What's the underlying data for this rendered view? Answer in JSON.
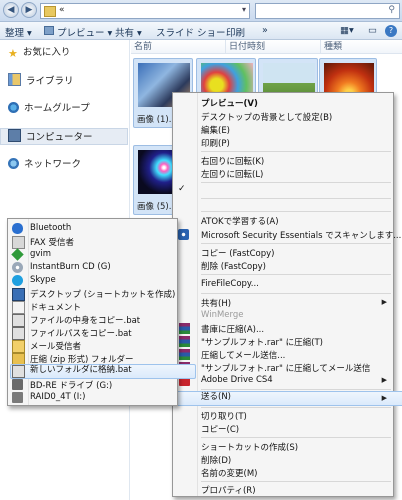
{
  "colors": {
    "accent": "#3a78c3",
    "menu_bg": "#f5f5f5",
    "highlight": "#dbeafb"
  },
  "address": {
    "path": "«",
    "nav_back_icon": "back-arrow-icon",
    "nav_forward_icon": "forward-arrow-icon"
  },
  "toolbar": {
    "organize": "整理 ▾",
    "preview": "プレビュー ▾",
    "share": "共有 ▾",
    "slideshow": "スライド ショー",
    "print": "印刷",
    "more": "»"
  },
  "nav": {
    "items": [
      {
        "label": "お気に入り",
        "icon": "star-icon"
      },
      {
        "label": "ライブラリ",
        "icon": "library-icon"
      },
      {
        "label": "ホームグループ",
        "icon": "homegroup-icon"
      },
      {
        "label": "コンピューター",
        "icon": "computer-icon"
      },
      {
        "label": "ネットワーク",
        "icon": "network-icon"
      }
    ]
  },
  "columns": {
    "name": "名前",
    "date": "日付時刻",
    "type": "種類"
  },
  "thumbs": [
    {
      "label": "画像 (1)."
    },
    {
      "label": ""
    },
    {
      "label": ""
    },
    {
      "label": ""
    },
    {
      "label": "画像 (5)."
    }
  ],
  "main_menu": {
    "items": [
      {
        "label": "プレビュー(V)",
        "bold": true
      },
      {
        "label": "デスクトップの背景として設定(B)"
      },
      {
        "label": "編集(E)"
      },
      {
        "label": "印刷(P)"
      },
      {
        "label": "右回りに回転(K)"
      },
      {
        "label": "左回りに回転(L)"
      },
      {
        "label": "ATOKで学習する(A)"
      },
      {
        "label": "Microsoft Security Essentials でスキャンします..."
      },
      {
        "label": "コピー (FastCopy)"
      },
      {
        "label": "削除  (FastCopy)"
      },
      {
        "label": "FireFileCopy..."
      },
      {
        "label": "共有(H)"
      },
      {
        "label": "WinMerge"
      },
      {
        "label": "書庫に圧縮(A)..."
      },
      {
        "label": "\"サンプルフォト.rar\" に圧縮(T)"
      },
      {
        "label": "圧縮してメール送信..."
      },
      {
        "label": "\"サンプルフォト.rar\" に圧縮してメール送信"
      },
      {
        "label": "Adobe Drive CS4"
      },
      {
        "label": "送る(N)"
      },
      {
        "label": "切り取り(T)"
      },
      {
        "label": "コピー(C)"
      },
      {
        "label": "ショートカットの作成(S)"
      },
      {
        "label": "削除(D)"
      },
      {
        "label": "名前の変更(M)"
      },
      {
        "label": "プロパティ(R)"
      }
    ]
  },
  "sendto_menu": {
    "items": [
      {
        "label": "Bluetooth"
      },
      {
        "label": "FAX 受信者"
      },
      {
        "label": "gvim"
      },
      {
        "label": "InstantBurn CD (G)"
      },
      {
        "label": "Skype"
      },
      {
        "label": "デスクトップ (ショートカットを作成)"
      },
      {
        "label": "ドキュメント"
      },
      {
        "label": "ファイルの中身をコピー.bat"
      },
      {
        "label": "ファイルパスをコピー.bat"
      },
      {
        "label": "メール受信者"
      },
      {
        "label": "圧縮 (zip 形式) フォルダー"
      },
      {
        "label": "新しいフォルダに格納.bat"
      },
      {
        "label": "BD-RE ドライブ (G:)"
      },
      {
        "label": "RAID0_4T (I:)"
      }
    ]
  }
}
